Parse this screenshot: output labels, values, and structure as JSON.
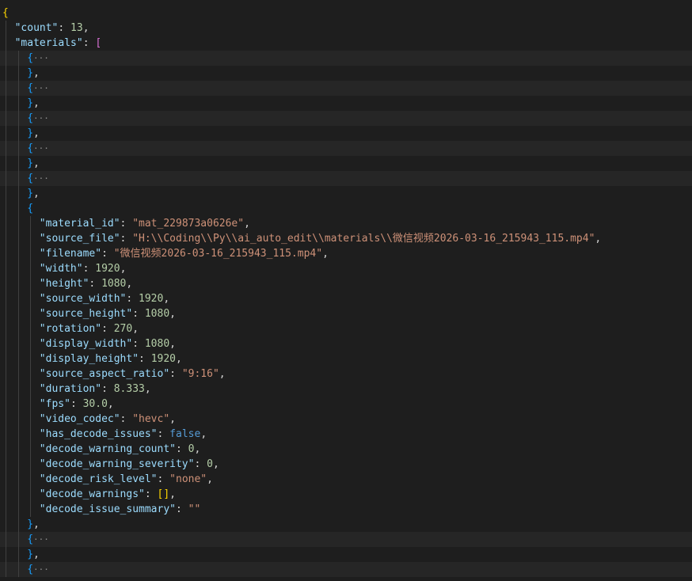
{
  "editor": {
    "theme_colors": {
      "background": "#1e1e1e",
      "key": "#9cdcfe",
      "string": "#ce9178",
      "number": "#b5cea8",
      "boolean": "#569cd6",
      "bracket_level_1": "#ffd700",
      "bracket_level_2": "#da70d6",
      "bracket_level_3": "#179fff"
    },
    "lines": [
      {
        "indent": 0,
        "tokens": [
          {
            "t": "{",
            "c": "b1"
          }
        ]
      },
      {
        "indent": 1,
        "tokens": [
          {
            "t": "\"count\"",
            "c": "key"
          },
          {
            "t": ": ",
            "c": "punc"
          },
          {
            "t": "13",
            "c": "num"
          },
          {
            "t": ",",
            "c": "punc"
          }
        ]
      },
      {
        "indent": 1,
        "tokens": [
          {
            "t": "\"materials\"",
            "c": "key"
          },
          {
            "t": ": ",
            "c": "punc"
          },
          {
            "t": "[",
            "c": "b2"
          }
        ]
      },
      {
        "indent": 2,
        "folded": true,
        "tokens": [
          {
            "t": "{",
            "c": "b3"
          },
          {
            "t": "···",
            "c": "ell"
          }
        ]
      },
      {
        "indent": 2,
        "tokens": [
          {
            "t": "}",
            "c": "b3"
          },
          {
            "t": ",",
            "c": "punc"
          }
        ]
      },
      {
        "indent": 2,
        "folded": true,
        "tokens": [
          {
            "t": "{",
            "c": "b3"
          },
          {
            "t": "···",
            "c": "ell"
          }
        ]
      },
      {
        "indent": 2,
        "tokens": [
          {
            "t": "}",
            "c": "b3"
          },
          {
            "t": ",",
            "c": "punc"
          }
        ]
      },
      {
        "indent": 2,
        "folded": true,
        "tokens": [
          {
            "t": "{",
            "c": "b3"
          },
          {
            "t": "···",
            "c": "ell"
          }
        ]
      },
      {
        "indent": 2,
        "tokens": [
          {
            "t": "}",
            "c": "b3"
          },
          {
            "t": ",",
            "c": "punc"
          }
        ]
      },
      {
        "indent": 2,
        "folded": true,
        "tokens": [
          {
            "t": "{",
            "c": "b3"
          },
          {
            "t": "···",
            "c": "ell"
          }
        ]
      },
      {
        "indent": 2,
        "tokens": [
          {
            "t": "}",
            "c": "b3"
          },
          {
            "t": ",",
            "c": "punc"
          }
        ]
      },
      {
        "indent": 2,
        "folded": true,
        "tokens": [
          {
            "t": "{",
            "c": "b3"
          },
          {
            "t": "···",
            "c": "ell"
          }
        ]
      },
      {
        "indent": 2,
        "tokens": [
          {
            "t": "}",
            "c": "b3"
          },
          {
            "t": ",",
            "c": "punc"
          }
        ]
      },
      {
        "indent": 2,
        "tokens": [
          {
            "t": "{",
            "c": "b3"
          }
        ]
      },
      {
        "indent": 3,
        "tokens": [
          {
            "t": "\"material_id\"",
            "c": "key"
          },
          {
            "t": ": ",
            "c": "punc"
          },
          {
            "t": "\"mat_229873a0626e\"",
            "c": "str"
          },
          {
            "t": ",",
            "c": "punc"
          }
        ]
      },
      {
        "indent": 3,
        "tokens": [
          {
            "t": "\"source_file\"",
            "c": "key"
          },
          {
            "t": ": ",
            "c": "punc"
          },
          {
            "t": "\"H:\\\\Coding\\\\Py\\\\ai_auto_edit\\\\materials\\\\微信视频2026-03-16_215943_115.mp4\"",
            "c": "str"
          },
          {
            "t": ",",
            "c": "punc"
          }
        ]
      },
      {
        "indent": 3,
        "tokens": [
          {
            "t": "\"filename\"",
            "c": "key"
          },
          {
            "t": ": ",
            "c": "punc"
          },
          {
            "t": "\"微信视频2026-03-16_215943_115.mp4\"",
            "c": "str"
          },
          {
            "t": ",",
            "c": "punc"
          }
        ]
      },
      {
        "indent": 3,
        "tokens": [
          {
            "t": "\"width\"",
            "c": "key"
          },
          {
            "t": ": ",
            "c": "punc"
          },
          {
            "t": "1920",
            "c": "num"
          },
          {
            "t": ",",
            "c": "punc"
          }
        ]
      },
      {
        "indent": 3,
        "tokens": [
          {
            "t": "\"height\"",
            "c": "key"
          },
          {
            "t": ": ",
            "c": "punc"
          },
          {
            "t": "1080",
            "c": "num"
          },
          {
            "t": ",",
            "c": "punc"
          }
        ]
      },
      {
        "indent": 3,
        "tokens": [
          {
            "t": "\"source_width\"",
            "c": "key"
          },
          {
            "t": ": ",
            "c": "punc"
          },
          {
            "t": "1920",
            "c": "num"
          },
          {
            "t": ",",
            "c": "punc"
          }
        ]
      },
      {
        "indent": 3,
        "tokens": [
          {
            "t": "\"source_height\"",
            "c": "key"
          },
          {
            "t": ": ",
            "c": "punc"
          },
          {
            "t": "1080",
            "c": "num"
          },
          {
            "t": ",",
            "c": "punc"
          }
        ]
      },
      {
        "indent": 3,
        "tokens": [
          {
            "t": "\"rotation\"",
            "c": "key"
          },
          {
            "t": ": ",
            "c": "punc"
          },
          {
            "t": "270",
            "c": "num"
          },
          {
            "t": ",",
            "c": "punc"
          }
        ]
      },
      {
        "indent": 3,
        "tokens": [
          {
            "t": "\"display_width\"",
            "c": "key"
          },
          {
            "t": ": ",
            "c": "punc"
          },
          {
            "t": "1080",
            "c": "num"
          },
          {
            "t": ",",
            "c": "punc"
          }
        ]
      },
      {
        "indent": 3,
        "tokens": [
          {
            "t": "\"display_height\"",
            "c": "key"
          },
          {
            "t": ": ",
            "c": "punc"
          },
          {
            "t": "1920",
            "c": "num"
          },
          {
            "t": ",",
            "c": "punc"
          }
        ]
      },
      {
        "indent": 3,
        "tokens": [
          {
            "t": "\"source_aspect_ratio\"",
            "c": "key"
          },
          {
            "t": ": ",
            "c": "punc"
          },
          {
            "t": "\"9:16\"",
            "c": "str"
          },
          {
            "t": ",",
            "c": "punc"
          }
        ]
      },
      {
        "indent": 3,
        "tokens": [
          {
            "t": "\"duration\"",
            "c": "key"
          },
          {
            "t": ": ",
            "c": "punc"
          },
          {
            "t": "8.333",
            "c": "num"
          },
          {
            "t": ",",
            "c": "punc"
          }
        ]
      },
      {
        "indent": 3,
        "tokens": [
          {
            "t": "\"fps\"",
            "c": "key"
          },
          {
            "t": ": ",
            "c": "punc"
          },
          {
            "t": "30.0",
            "c": "num"
          },
          {
            "t": ",",
            "c": "punc"
          }
        ]
      },
      {
        "indent": 3,
        "tokens": [
          {
            "t": "\"video_codec\"",
            "c": "key"
          },
          {
            "t": ": ",
            "c": "punc"
          },
          {
            "t": "\"hevc\"",
            "c": "str"
          },
          {
            "t": ",",
            "c": "punc"
          }
        ]
      },
      {
        "indent": 3,
        "tokens": [
          {
            "t": "\"has_decode_issues\"",
            "c": "key"
          },
          {
            "t": ": ",
            "c": "punc"
          },
          {
            "t": "false",
            "c": "bool"
          },
          {
            "t": ",",
            "c": "punc"
          }
        ]
      },
      {
        "indent": 3,
        "tokens": [
          {
            "t": "\"decode_warning_count\"",
            "c": "key"
          },
          {
            "t": ": ",
            "c": "punc"
          },
          {
            "t": "0",
            "c": "num"
          },
          {
            "t": ",",
            "c": "punc"
          }
        ]
      },
      {
        "indent": 3,
        "tokens": [
          {
            "t": "\"decode_warning_severity\"",
            "c": "key"
          },
          {
            "t": ": ",
            "c": "punc"
          },
          {
            "t": "0",
            "c": "num"
          },
          {
            "t": ",",
            "c": "punc"
          }
        ]
      },
      {
        "indent": 3,
        "tokens": [
          {
            "t": "\"decode_risk_level\"",
            "c": "key"
          },
          {
            "t": ": ",
            "c": "punc"
          },
          {
            "t": "\"none\"",
            "c": "str"
          },
          {
            "t": ",",
            "c": "punc"
          }
        ]
      },
      {
        "indent": 3,
        "tokens": [
          {
            "t": "\"decode_warnings\"",
            "c": "key"
          },
          {
            "t": ": ",
            "c": "punc"
          },
          {
            "t": "[]",
            "c": "b1"
          },
          {
            "t": ",",
            "c": "punc"
          }
        ]
      },
      {
        "indent": 3,
        "tokens": [
          {
            "t": "\"decode_issue_summary\"",
            "c": "key"
          },
          {
            "t": ": ",
            "c": "punc"
          },
          {
            "t": "\"\"",
            "c": "str"
          }
        ]
      },
      {
        "indent": 2,
        "tokens": [
          {
            "t": "}",
            "c": "b3"
          },
          {
            "t": ",",
            "c": "punc"
          }
        ]
      },
      {
        "indent": 2,
        "folded": true,
        "tokens": [
          {
            "t": "{",
            "c": "b3"
          },
          {
            "t": "···",
            "c": "ell"
          }
        ]
      },
      {
        "indent": 2,
        "tokens": [
          {
            "t": "}",
            "c": "b3"
          },
          {
            "t": ",",
            "c": "punc"
          }
        ]
      },
      {
        "indent": 2,
        "folded": true,
        "tokens": [
          {
            "t": "{",
            "c": "b3"
          },
          {
            "t": "···",
            "c": "ell"
          }
        ]
      }
    ]
  }
}
